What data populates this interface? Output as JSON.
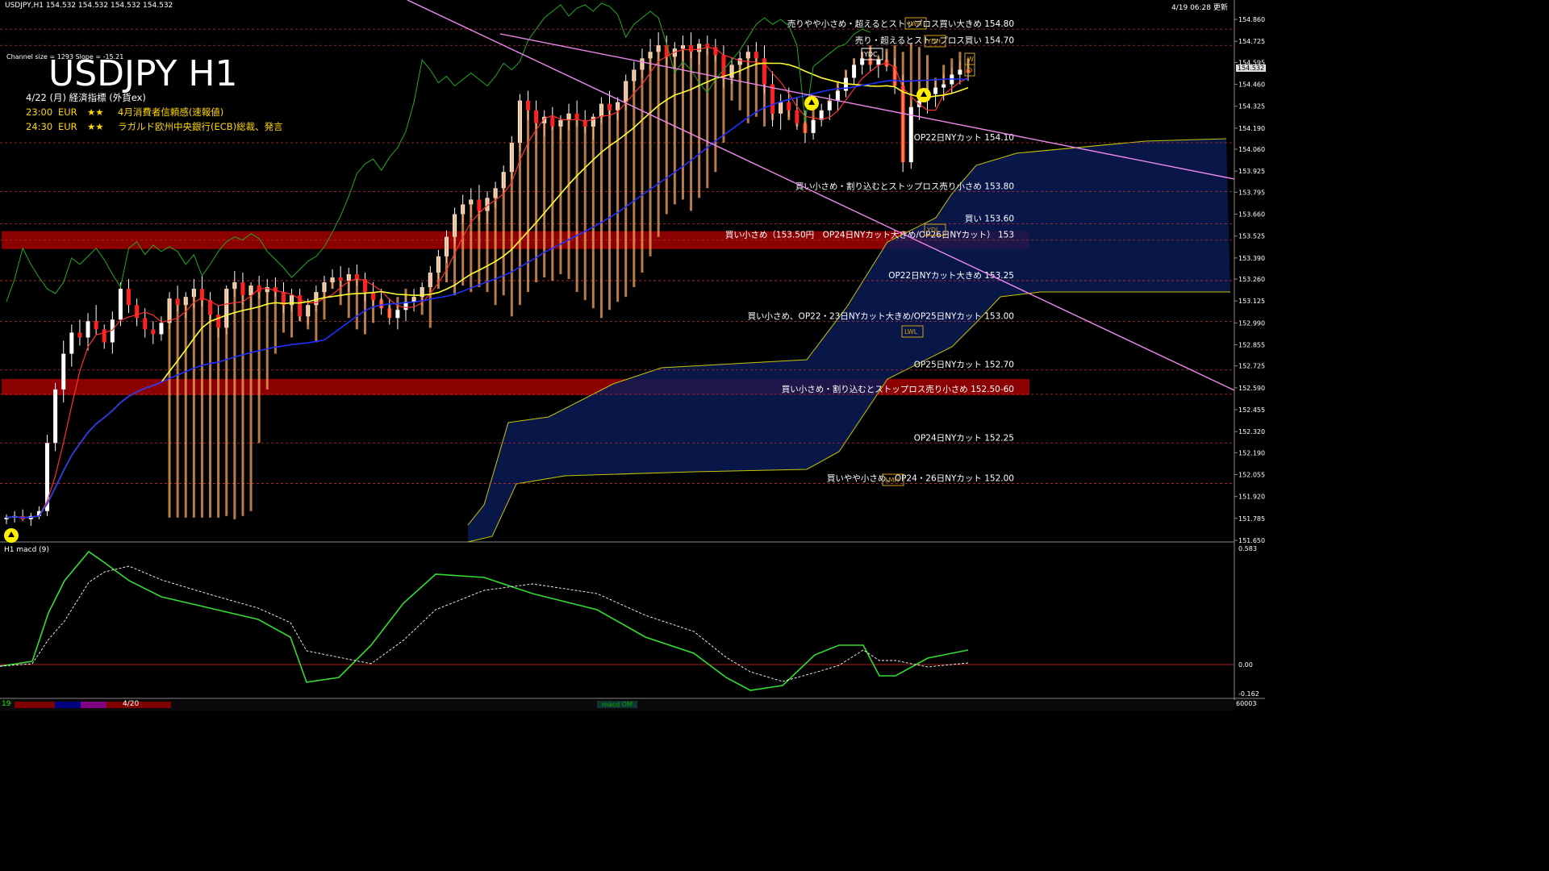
{
  "window": {
    "header_left": "USDJPY,H1  154.532 154.532 154.532 154.532",
    "header_right": "4/19 06:28 更新"
  },
  "chart_title": "USDJPY H1",
  "channel_info": "Channel size = 1293 Slope = -15.21",
  "calendar": {
    "date_line": "4/22 (月) 経済指標 (外貨ex)",
    "events": [
      {
        "time": "23:00",
        "currency": "EUR",
        "stars": "★★",
        "name": "4月消費者信頼感(速報値)"
      },
      {
        "time": "24:30",
        "currency": "EUR",
        "stars": "★★",
        "name": "ラガルド欧州中央銀行(ECB)総裁、発言"
      }
    ]
  },
  "current_price_tag": "154.532",
  "macd_label": "H1  macd (9)",
  "macd_axis": [
    "0.583",
    "0.00",
    "-0.162"
  ],
  "bottom_bar": {
    "left": "19",
    "mid": "4/20",
    "right_code": "60003",
    "center_tag": "macd OM"
  },
  "level_tags": [
    "YDC",
    "YDH",
    "YDL",
    "LWH",
    "LWL",
    "LMH",
    "W",
    "D"
  ],
  "chart_data": {
    "type": "candlestick",
    "symbol": "USDJPY",
    "timeframe": "H1",
    "ylim": [
      151.65,
      154.92
    ],
    "y_ticks": [
      "154.860",
      "154.725",
      "154.595",
      "154.460",
      "154.325",
      "154.190",
      "154.060",
      "153.925",
      "153.795",
      "153.660",
      "153.525",
      "153.390",
      "153.260",
      "153.125",
      "152.990",
      "152.855",
      "152.725",
      "152.590",
      "152.455",
      "152.320",
      "152.190",
      "152.055",
      "151.920",
      "151.785",
      "151.650"
    ],
    "red_zones": [
      {
        "low": 153.445,
        "high": 153.555
      },
      {
        "low": 152.545,
        "high": 152.645
      }
    ],
    "order_levels": [
      {
        "price": 154.8,
        "label": "売りやや小さめ・超えるとストップロス買い大きめ 154.80"
      },
      {
        "price": 154.7,
        "label": "売り・超えるとストップロス買い 154.70"
      },
      {
        "price": 154.1,
        "label": "OP22日NYカット 154.10"
      },
      {
        "price": 153.8,
        "label": "買い小さめ・割り込むとストップロス売り小さめ 153.80"
      },
      {
        "price": 153.6,
        "label": "買い 153.60"
      },
      {
        "price": 153.5,
        "label": "買い小さめ（153.50円　OP24日NYカット大きめ/OP26日NYカット） 153"
      },
      {
        "price": 153.25,
        "label": "OP22日NYカット大きめ 153.25"
      },
      {
        "price": 153.0,
        "label": "買い小さめ、OP22・23日NYカット大きめ/OP25日NYカット 153.00"
      },
      {
        "price": 152.7,
        "label": "OP25日NYカット 152.70"
      },
      {
        "price": 152.55,
        "label": "買い小さめ・割り込むとストップロス売り小さめ 152.50-60"
      },
      {
        "price": 152.25,
        "label": "OP24日NYカット 152.25"
      },
      {
        "price": 152.0,
        "label": "買いやや小さめ、OP24・26日NYカット 152.00"
      }
    ],
    "candles": [
      [
        151.78,
        151.81,
        151.75,
        151.79
      ],
      [
        151.79,
        151.83,
        151.76,
        151.8
      ],
      [
        151.8,
        151.84,
        151.77,
        151.78
      ],
      [
        151.78,
        151.82,
        151.74,
        151.8
      ],
      [
        151.8,
        151.86,
        151.78,
        151.83
      ],
      [
        151.83,
        152.3,
        151.8,
        152.25
      ],
      [
        152.25,
        152.62,
        152.2,
        152.58
      ],
      [
        152.58,
        152.88,
        152.5,
        152.8
      ],
      [
        152.8,
        152.98,
        152.72,
        152.93
      ],
      [
        152.93,
        153.01,
        152.85,
        152.9
      ],
      [
        152.9,
        153.05,
        152.82,
        153.0
      ],
      [
        153.0,
        153.1,
        152.92,
        152.95
      ],
      [
        152.95,
        152.98,
        152.83,
        152.87
      ],
      [
        152.87,
        153.06,
        152.8,
        153.01
      ],
      [
        153.01,
        153.24,
        152.97,
        153.2
      ],
      [
        153.2,
        153.26,
        153.05,
        153.1
      ],
      [
        153.1,
        153.14,
        152.97,
        153.02
      ],
      [
        153.02,
        153.08,
        152.9,
        152.95
      ],
      [
        152.95,
        153.0,
        152.86,
        152.92
      ],
      [
        152.92,
        153.03,
        152.88,
        152.99
      ],
      [
        152.99,
        153.18,
        152.95,
        153.14
      ],
      [
        153.14,
        153.22,
        153.06,
        153.1
      ],
      [
        153.1,
        153.18,
        153.02,
        153.15
      ],
      [
        153.15,
        153.26,
        153.08,
        153.2
      ],
      [
        153.2,
        153.28,
        153.09,
        153.13
      ],
      [
        153.13,
        153.18,
        152.99,
        153.04
      ],
      [
        153.04,
        153.1,
        152.9,
        152.96
      ],
      [
        152.96,
        153.22,
        152.92,
        153.2
      ],
      [
        153.2,
        153.31,
        153.15,
        153.24
      ],
      [
        153.24,
        153.3,
        153.1,
        153.16
      ],
      [
        153.16,
        153.24,
        153.08,
        153.22
      ],
      [
        153.22,
        153.28,
        153.14,
        153.18
      ],
      [
        153.18,
        153.26,
        153.1,
        153.21
      ],
      [
        153.21,
        153.27,
        153.15,
        153.18
      ],
      [
        153.18,
        153.24,
        153.05,
        153.1
      ],
      [
        153.1,
        153.2,
        153.06,
        153.16
      ],
      [
        153.16,
        153.2,
        153.0,
        153.03
      ],
      [
        153.03,
        153.14,
        152.98,
        153.1
      ],
      [
        153.1,
        153.22,
        153.06,
        153.18
      ],
      [
        153.18,
        153.28,
        153.14,
        153.24
      ],
      [
        153.24,
        153.32,
        153.2,
        153.27
      ],
      [
        153.27,
        153.34,
        153.2,
        153.25
      ],
      [
        153.25,
        153.33,
        153.18,
        153.29
      ],
      [
        153.29,
        153.35,
        153.22,
        153.26
      ],
      [
        153.26,
        153.3,
        153.12,
        153.18
      ],
      [
        153.18,
        153.24,
        153.1,
        153.13
      ],
      [
        153.13,
        153.2,
        153.04,
        153.08
      ],
      [
        153.08,
        153.14,
        152.98,
        153.02
      ],
      [
        153.02,
        153.1,
        152.95,
        153.07
      ],
      [
        153.07,
        153.16,
        153.0,
        153.12
      ],
      [
        153.12,
        153.2,
        153.06,
        153.15
      ],
      [
        153.15,
        153.24,
        153.1,
        153.21
      ],
      [
        153.21,
        153.34,
        153.18,
        153.3
      ],
      [
        153.3,
        153.44,
        153.26,
        153.4
      ],
      [
        153.4,
        153.56,
        153.36,
        153.52
      ],
      [
        153.52,
        153.7,
        153.48,
        153.66
      ],
      [
        153.66,
        153.78,
        153.6,
        153.72
      ],
      [
        153.72,
        153.82,
        153.64,
        153.75
      ],
      [
        153.75,
        153.84,
        153.62,
        153.68
      ],
      [
        153.68,
        153.8,
        153.6,
        153.76
      ],
      [
        153.76,
        153.86,
        153.7,
        153.82
      ],
      [
        153.82,
        153.96,
        153.78,
        153.92
      ],
      [
        153.92,
        154.14,
        153.88,
        154.1
      ],
      [
        154.1,
        154.4,
        154.05,
        154.36
      ],
      [
        154.36,
        154.42,
        154.24,
        154.3
      ],
      [
        154.3,
        154.36,
        154.18,
        154.22
      ],
      [
        154.22,
        154.3,
        154.14,
        154.26
      ],
      [
        154.26,
        154.32,
        154.18,
        154.2
      ],
      [
        154.2,
        154.27,
        154.12,
        154.24
      ],
      [
        154.24,
        154.34,
        154.18,
        154.28
      ],
      [
        154.28,
        154.36,
        154.2,
        154.24
      ],
      [
        154.24,
        154.3,
        154.16,
        154.2
      ],
      [
        154.2,
        154.28,
        154.12,
        154.26
      ],
      [
        154.26,
        154.38,
        154.22,
        154.34
      ],
      [
        154.34,
        154.42,
        154.26,
        154.3
      ],
      [
        154.3,
        154.38,
        154.24,
        154.35
      ],
      [
        154.35,
        154.52,
        154.3,
        154.48
      ],
      [
        154.48,
        154.6,
        154.42,
        154.55
      ],
      [
        154.55,
        154.68,
        154.5,
        154.62
      ],
      [
        154.62,
        154.74,
        154.55,
        154.66
      ],
      [
        154.66,
        154.78,
        154.6,
        154.7
      ],
      [
        154.7,
        154.76,
        154.58,
        154.63
      ],
      [
        154.63,
        154.72,
        154.56,
        154.68
      ],
      [
        154.68,
        154.76,
        154.6,
        154.7
      ],
      [
        154.7,
        154.78,
        154.62,
        154.66
      ],
      [
        154.66,
        154.74,
        154.58,
        154.71
      ],
      [
        154.71,
        154.76,
        154.64,
        154.69
      ],
      [
        154.69,
        154.74,
        154.6,
        154.64
      ],
      [
        154.64,
        154.7,
        154.44,
        154.5
      ],
      [
        154.5,
        154.62,
        154.46,
        154.58
      ],
      [
        154.58,
        154.66,
        154.52,
        154.62
      ],
      [
        154.62,
        154.7,
        154.56,
        154.66
      ],
      [
        154.66,
        154.72,
        154.58,
        154.62
      ],
      [
        154.62,
        154.7,
        154.4,
        154.46
      ],
      [
        154.46,
        154.54,
        154.2,
        154.28
      ],
      [
        154.28,
        154.4,
        154.18,
        154.35
      ],
      [
        154.35,
        154.44,
        154.26,
        154.3
      ],
      [
        154.3,
        154.38,
        154.18,
        154.22
      ],
      [
        154.22,
        154.3,
        154.1,
        154.16
      ],
      [
        154.16,
        154.26,
        154.12,
        154.24
      ],
      [
        154.24,
        154.34,
        154.2,
        154.3
      ],
      [
        154.3,
        154.4,
        154.24,
        154.36
      ],
      [
        154.36,
        154.46,
        154.3,
        154.42
      ],
      [
        154.42,
        154.54,
        154.38,
        154.5
      ],
      [
        154.5,
        154.62,
        154.46,
        154.58
      ],
      [
        154.58,
        154.66,
        154.52,
        154.62
      ],
      [
        154.62,
        154.68,
        154.54,
        154.58
      ],
      [
        154.58,
        154.64,
        154.5,
        154.61
      ],
      [
        154.61,
        154.66,
        154.54,
        154.57
      ],
      [
        154.57,
        154.62,
        154.4,
        154.45
      ],
      [
        154.45,
        154.52,
        153.92,
        153.98
      ],
      [
        153.98,
        154.36,
        153.94,
        154.32
      ],
      [
        154.32,
        154.4,
        154.24,
        154.36
      ],
      [
        154.36,
        154.44,
        154.28,
        154.4
      ],
      [
        154.4,
        154.48,
        154.32,
        154.44
      ],
      [
        154.44,
        154.52,
        154.36,
        154.46
      ],
      [
        154.46,
        154.56,
        154.4,
        154.52
      ],
      [
        154.52,
        154.6,
        154.46,
        154.55
      ],
      [
        154.55,
        154.62,
        154.48,
        154.53
      ]
    ]
  }
}
